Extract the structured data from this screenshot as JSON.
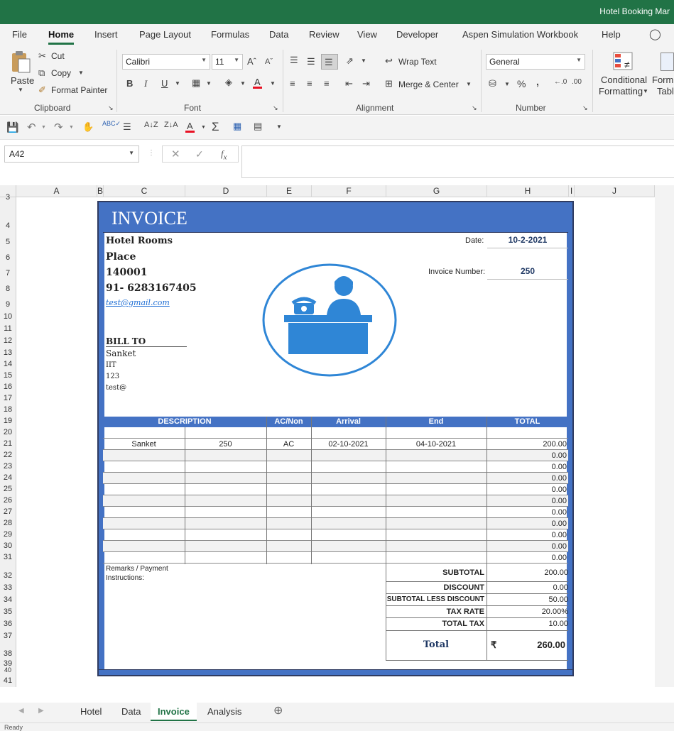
{
  "app": {
    "title": "Hotel Booking Mar"
  },
  "ribbon_tabs": [
    "File",
    "Home",
    "Insert",
    "Page Layout",
    "Formulas",
    "Data",
    "Review",
    "View",
    "Developer",
    "Aspen Simulation Workbook",
    "Help"
  ],
  "ribbon": {
    "paste": "Paste",
    "cut": "Cut",
    "copy": "Copy",
    "format_painter": "Format Painter",
    "clipboard": "Clipboard",
    "font_name": "Calibri",
    "font_size": "11",
    "font": "Font",
    "wrap_text": "Wrap Text",
    "merge_center": "Merge & Center",
    "alignment": "Alignment",
    "number_format": "General",
    "number": "Number",
    "cond_fmt_1": "Conditional",
    "cond_fmt_2": "Formatting",
    "fmt_as_1": "Form",
    "fmt_as_2": "Tabl",
    "bold": "B",
    "italic": "I",
    "underline": "U",
    "percent": "%",
    "comma": ","
  },
  "formula_bar": {
    "name_box": "A42",
    "formula": ""
  },
  "columns": [
    "A",
    "B",
    "C",
    "D",
    "E",
    "F",
    "G",
    "H",
    "I",
    "J"
  ],
  "rows": [
    "3",
    "4",
    "5",
    "6",
    "7",
    "8",
    "9",
    "10",
    "11",
    "12",
    "13",
    "14",
    "15",
    "16",
    "17",
    "18",
    "19",
    "20",
    "21",
    "22",
    "23",
    "24",
    "25",
    "26",
    "27",
    "28",
    "29",
    "30",
    "31",
    "32",
    "33",
    "34",
    "35",
    "36",
    "37",
    "38",
    "39",
    "40",
    "41"
  ],
  "invoice": {
    "title": "INVOICE",
    "hotel_name": "Hotel Rooms",
    "place": "Place",
    "pin": "140001",
    "phone": "91- 6283167405",
    "email": "test@gmail.com",
    "date_label": "Date:",
    "date_value": "10-2-2021",
    "invoice_no_label": "Invoice Number:",
    "invoice_no_value": "250",
    "bill_to": "BILL TO",
    "bill_name": "Sanket",
    "bill_line2": "IIT",
    "bill_line3": "123",
    "bill_email": "test@",
    "headers": [
      "DESCRIPTION",
      "AC/Non",
      "Arrival",
      "End",
      "TOTAL"
    ],
    "item": {
      "desc": "Sanket",
      "qty": "250",
      "type": "AC",
      "arrival": "02-10-2021",
      "end": "04-10-2021",
      "total": "200.00"
    },
    "zero": "0.00",
    "remarks_1": "Remarks / Payment",
    "remarks_2": "Instructions:",
    "subtotal_label": "SUBTOTAL",
    "subtotal": "200.00",
    "discount_label": "DISCOUNT",
    "discount": "0.00",
    "sub_less_label": "SUBTOTAL LESS DISCOUNT",
    "sub_less": "50.00",
    "tax_rate_label": "TAX RATE",
    "tax_rate": "20.00%",
    "total_tax_label": "TOTAL TAX",
    "total_tax": "10.00",
    "total_label": "Total",
    "currency": "₹",
    "total": "260.00"
  },
  "sheet_tabs": [
    "Hotel",
    "Data",
    "Invoice",
    "Analysis"
  ],
  "status": {
    "ready": "Ready"
  },
  "colors": {
    "excel_green": "#217346",
    "invoice_blue": "#4472c4",
    "logo_blue": "#2f86d6"
  }
}
